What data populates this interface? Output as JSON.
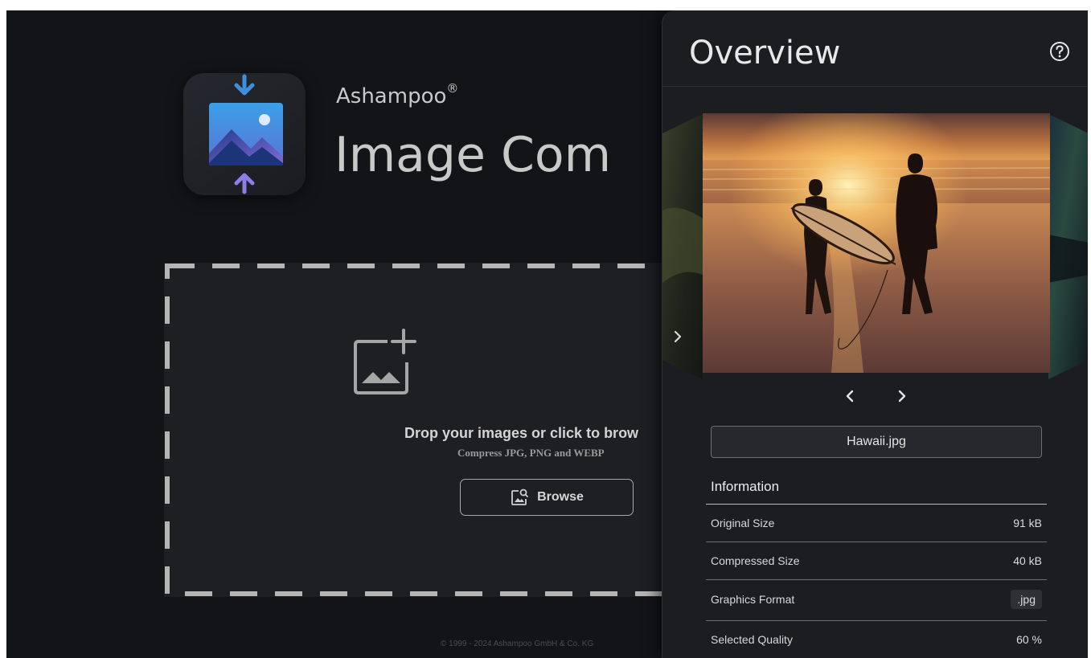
{
  "app": {
    "brand": "Ashampoo",
    "brand_mark": "®",
    "product": "Image Com",
    "copyright": "© 1999 - 2024 Ashampoo GmbH & Co. KG"
  },
  "dropzone": {
    "title": "Drop your images or click to brow",
    "subtitle": "Compress JPG, PNG and WEBP",
    "browse_label": "Browse"
  },
  "panel": {
    "title": "Overview",
    "filename": "Hawaii.jpg",
    "info_heading": "Information",
    "rows": [
      {
        "label": "Original Size",
        "value": "91 kB"
      },
      {
        "label": "Compressed Size",
        "value": "40 kB"
      },
      {
        "label": "Graphics Format",
        "value": ".jpg"
      },
      {
        "label": "Selected Quality",
        "value": "60 %"
      }
    ]
  },
  "icons": {
    "logo": "image-compressor-logo-icon",
    "add_image": "add-image-icon",
    "browse": "browse-image-icon",
    "help": "help-icon",
    "prev": "chevron-left-icon",
    "next": "chevron-right-icon"
  },
  "colors": {
    "background": "#121418",
    "panel": "#1c1d21",
    "accent_blue": "#3f8fdc",
    "accent_purple": "#8b7fe6"
  }
}
